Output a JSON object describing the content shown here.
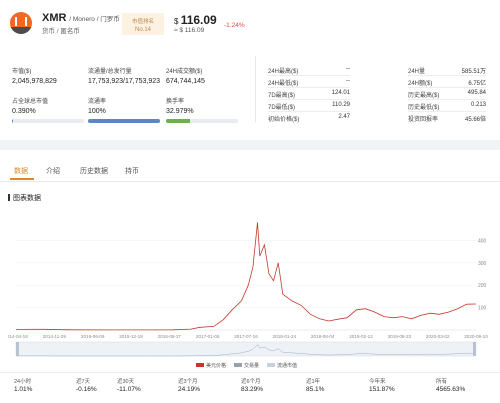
{
  "coin": {
    "symbol": "XMR",
    "name": "/ Monero / 门罗币",
    "tags": "货币 / 匿名币",
    "rank_label": "市值排名",
    "rank": "No.14",
    "price_usd": "116.09",
    "price_cny": "≈ $ 116.09",
    "change": "-1.24%",
    "currency_symbol": "$"
  },
  "stats": {
    "market_cap_label": "市值($)",
    "market_cap": "2,045,978,829",
    "supply_label": "流通量/总发行量",
    "supply": "17,753,923/17,753,923",
    "volume_label": "24H成交额($)",
    "volume": "674,744,145",
    "share_label": "占全球总市值",
    "share": "0.390%",
    "share_pct": 0.39,
    "circ_label": "流通率",
    "circ": "100%",
    "circ_pct": 100,
    "turnover_label": "换手率",
    "turnover": "32.979%",
    "turnover_pct": 32.979
  },
  "mid_table": [
    {
      "label": "24H最高($)",
      "value": "--"
    },
    {
      "label": "24H最低($)",
      "value": "--"
    },
    {
      "label": "7D最高($)",
      "value": "124.01"
    },
    {
      "label": "7D最低($)",
      "value": "110.29"
    },
    {
      "label": "初始价格($)",
      "value": "2.47"
    }
  ],
  "right_table": [
    {
      "label": "24H量",
      "value": "585.51万"
    },
    {
      "label": "24H额($)",
      "value": "6.75亿"
    },
    {
      "label": "历史最高($)",
      "value": "495.84"
    },
    {
      "label": "历史最低($)",
      "value": "0.213"
    },
    {
      "label": "投资回报率",
      "value": "45.66倍"
    }
  ],
  "tabs": [
    {
      "label": "数据"
    },
    {
      "label": "介绍"
    },
    {
      "label": "历史数据"
    },
    {
      "label": "持币"
    }
  ],
  "chart_title": "图表数据",
  "chart_data": {
    "type": "line",
    "x": [
      "2014-04-18",
      "2014-11-29",
      "2015-06-09",
      "2015-12-18",
      "2016-06-27",
      "2017-01-05",
      "2017-07-16",
      "2018-01-24",
      "2018-08-04",
      "2019-02-12",
      "2019-08-23",
      "2020-03-02",
      "2020-09-10"
    ],
    "ylim": [
      0,
      500
    ],
    "yticks": [
      100,
      200,
      300,
      400
    ],
    "series": [
      {
        "name": "美元价格",
        "color": "#c0392b",
        "points": [
          [
            0,
            2.5
          ],
          [
            0.06,
            3
          ],
          [
            0.12,
            1
          ],
          [
            0.2,
            0.5
          ],
          [
            0.28,
            0.6
          ],
          [
            0.34,
            1
          ],
          [
            0.38,
            4
          ],
          [
            0.4,
            12
          ],
          [
            0.43,
            16
          ],
          [
            0.45,
            45
          ],
          [
            0.47,
            90
          ],
          [
            0.49,
            130
          ],
          [
            0.505,
            200
          ],
          [
            0.515,
            280
          ],
          [
            0.52,
            380
          ],
          [
            0.525,
            480
          ],
          [
            0.53,
            330
          ],
          [
            0.54,
            380
          ],
          [
            0.55,
            250
          ],
          [
            0.56,
            220
          ],
          [
            0.57,
            300
          ],
          [
            0.58,
            160
          ],
          [
            0.6,
            130
          ],
          [
            0.62,
            110
          ],
          [
            0.64,
            70
          ],
          [
            0.66,
            50
          ],
          [
            0.68,
            40
          ],
          [
            0.7,
            48
          ],
          [
            0.72,
            55
          ],
          [
            0.74,
            90
          ],
          [
            0.76,
            95
          ],
          [
            0.78,
            80
          ],
          [
            0.8,
            60
          ],
          [
            0.82,
            55
          ],
          [
            0.84,
            60
          ],
          [
            0.86,
            50
          ],
          [
            0.88,
            65
          ],
          [
            0.9,
            75
          ],
          [
            0.92,
            70
          ],
          [
            0.94,
            80
          ],
          [
            0.96,
            95
          ],
          [
            0.98,
            115
          ],
          [
            1,
            116
          ]
        ]
      },
      {
        "name": "交易量",
        "color": "#9aa1ad"
      },
      {
        "name": "流通市值",
        "color": "#c8d1de"
      }
    ]
  },
  "returns": [
    {
      "label": "24小时",
      "value": "1.01%"
    },
    {
      "label": "近7天",
      "value": "-0.16%"
    },
    {
      "label": "近30天",
      "value": "-11.07%"
    },
    {
      "label": "近3个月",
      "value": "24.19%"
    },
    {
      "label": "近6个月",
      "value": "83.29%"
    },
    {
      "label": "近1年",
      "value": "85.1%"
    },
    {
      "label": "今年来",
      "value": "151.87%"
    },
    {
      "label": "所有",
      "value": "4565.63%"
    }
  ]
}
